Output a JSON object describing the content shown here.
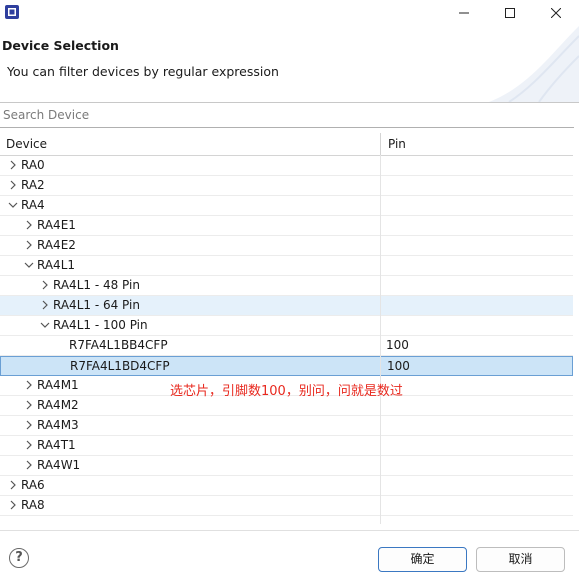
{
  "dialog": {
    "title": "Device Selection",
    "description": "You can filter devices by regular expression"
  },
  "search": {
    "placeholder": "Search Device",
    "value": ""
  },
  "tree": {
    "columns": [
      "Device",
      "Pin"
    ],
    "rows": [
      {
        "label": "RA0",
        "pin": "",
        "expanded": false,
        "depth": 0
      },
      {
        "label": "RA2",
        "pin": "",
        "expanded": false,
        "depth": 0
      },
      {
        "label": "RA4",
        "pin": "",
        "expanded": true,
        "depth": 0
      },
      {
        "label": "RA4E1",
        "pin": "",
        "expanded": false,
        "depth": 1
      },
      {
        "label": "RA4E2",
        "pin": "",
        "expanded": false,
        "depth": 1
      },
      {
        "label": "RA4L1",
        "pin": "",
        "expanded": true,
        "depth": 1
      },
      {
        "label": "RA4L1 - 48 Pin",
        "pin": "",
        "expanded": false,
        "depth": 2
      },
      {
        "label": "RA4L1 - 64 Pin",
        "pin": "",
        "expanded": false,
        "depth": 2,
        "hover": true
      },
      {
        "label": "RA4L1 - 100 Pin",
        "pin": "",
        "expanded": true,
        "depth": 2
      },
      {
        "label": "R7FA4L1BB4CFP",
        "pin": "100",
        "leaf": true,
        "depth": 3
      },
      {
        "label": "R7FA4L1BD4CFP",
        "pin": "100",
        "leaf": true,
        "depth": 3,
        "selected": true
      },
      {
        "label": "RA4M1",
        "pin": "",
        "expanded": false,
        "depth": 1
      },
      {
        "label": "RA4M2",
        "pin": "",
        "expanded": false,
        "depth": 1
      },
      {
        "label": "RA4M3",
        "pin": "",
        "expanded": false,
        "depth": 1
      },
      {
        "label": "RA4T1",
        "pin": "",
        "expanded": false,
        "depth": 1
      },
      {
        "label": "RA4W1",
        "pin": "",
        "expanded": false,
        "depth": 1
      },
      {
        "label": "RA6",
        "pin": "",
        "expanded": false,
        "depth": 0
      },
      {
        "label": "RA8",
        "pin": "",
        "expanded": false,
        "depth": 0
      }
    ]
  },
  "annotation": "选芯片，引脚数100，别问，问就是数过",
  "buttons": {
    "ok": "确定",
    "cancel": "取消",
    "help": "?"
  },
  "icons": {
    "app": "app-chip-icon",
    "minimize": "minimize-icon",
    "maximize": "maximize-icon",
    "close": "close-icon",
    "collapsed": "chevron-right-icon",
    "expanded": "chevron-down-icon",
    "help": "help-icon"
  },
  "colors": {
    "selection": "#cce4f7",
    "selection_border": "#6a9fd4",
    "hover": "#e5f1fb",
    "annotation": "#e8281e",
    "ok_border": "#3b78c2"
  }
}
